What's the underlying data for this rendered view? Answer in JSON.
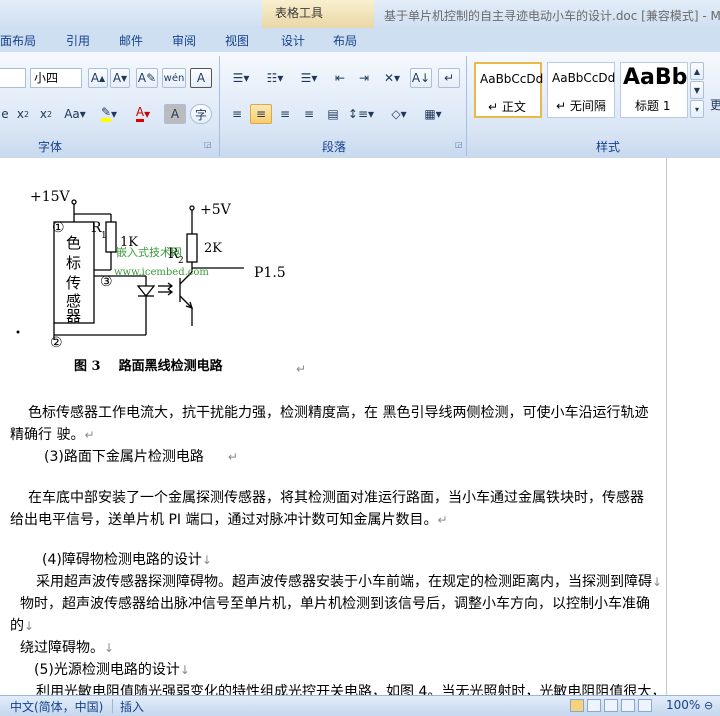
{
  "window": {
    "context_tab": "表格工具",
    "title": "基于单片机控制的自主寻迹电动小车的设计.doc [兼容模式] - M"
  },
  "menu": [
    "面布局",
    "引用",
    "邮件",
    "审阅",
    "视图",
    "设计",
    "布局"
  ],
  "ribbon": {
    "font_size": "小四",
    "groups": {
      "font": "字体",
      "paragraph": "段落",
      "styles": "样式"
    },
    "styles": [
      {
        "sample": "AaBbCcDd",
        "name": "↵ 正文"
      },
      {
        "sample": "AaBbCcDd",
        "name": "↵ 无间隔"
      },
      {
        "sample": "AaBb",
        "name": "标题 1"
      }
    ],
    "more_label": "更"
  },
  "figure": {
    "v15": "+15V",
    "v5": "+5V",
    "node1": "①",
    "node2": "②",
    "node3": "③",
    "r1": "R",
    "r1_sub": "1",
    "r1_value": "1K",
    "r2": "R",
    "r2_sub": "2",
    "r2_value": "2K",
    "sensor": [
      "色",
      "标",
      "传",
      "感",
      "器"
    ],
    "p15": "P1.5",
    "watermark_cn": "嵌入式技术网",
    "watermark_url": "www.icembed.com",
    "caption": "图 3    路面黑线检测电路"
  },
  "body": {
    "p1_line1": "色标传感器工作电流大，抗干扰能力强，检测精度高，在  黑色引导线两侧检测，可使小车沿运行轨迹",
    "p1_line2": "精确行    驶。",
    "h3": "(3)路面下金属片检测电路",
    "p2_line1": "在车底中部安装了一个金属探测传感器，将其检测面对准运行路面，当小车通过金属铁块时，传感器",
    "p2_line2": "给出电平信号，送单片机 PI 端口，通过对脉冲计数可知金属片数目。",
    "h4": "(4)障碍物检测电路的设计",
    "p3_line1": "采用超声波传感器探测障碍物。超声波传感器安装于小车前端，在规定的检测距离内，当探测到障碍",
    "p3_line2": "物时，超声波传感器给出脉冲信号至单片机，单片机检测到该信号后，调整小车方向，以控制小车准确",
    "p3_line3": "的",
    "p3_line4": "绕过障碍物。",
    "h5": "(5)光源检测电路的设计",
    "p4_line1": "利用光敏电阻值随光强弱变化的特性组成光控开关电路，如图 4。当无光照射时，光敏电阻阻值很大，"
  },
  "status": {
    "language": "中文(简体，中国)",
    "mode": "插入",
    "zoom": "100%"
  }
}
